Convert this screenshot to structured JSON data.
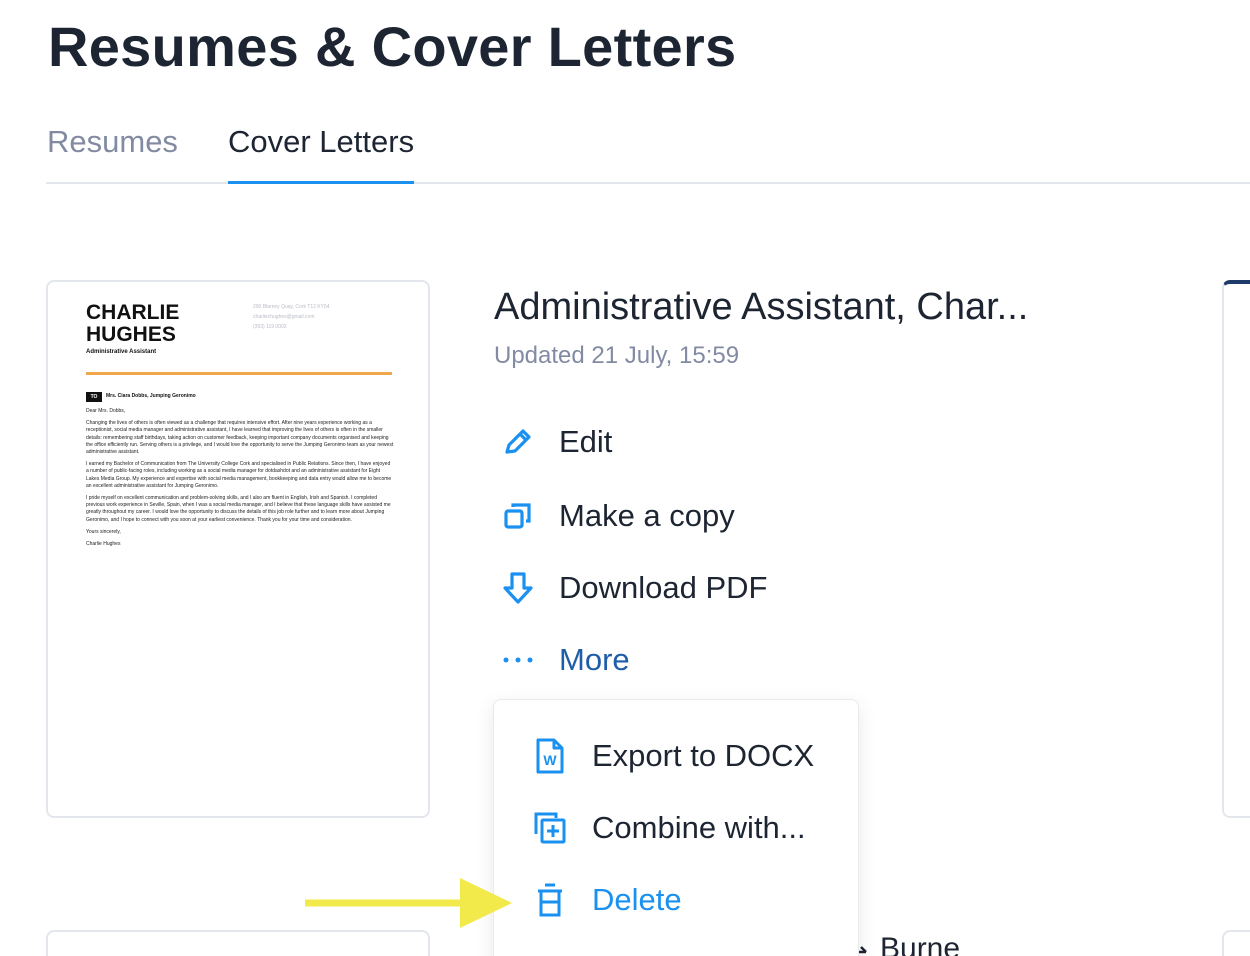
{
  "header": {
    "title": "Resumes & Cover Letters"
  },
  "tabs": [
    {
      "label": "Resumes",
      "active": false
    },
    {
      "label": "Cover Letters",
      "active": true
    }
  ],
  "document": {
    "title": "Administrative Assistant, Char...",
    "updated": "Updated 21 July, 15:59",
    "preview": {
      "name_line1": "CHARLIE",
      "name_line2": "HUGHES",
      "role": "Administrative Assistant",
      "contact_line1": "200 Blarney Quay, Cork T12 KY54",
      "contact_line2": "charliechughes@gmail.com",
      "contact_line3": "(353) 119 0002",
      "to_tag": "TO",
      "to_name": "Mrs. Ciara Dobbs, Jumping Geronimo",
      "greeting": "Dear Mrs. Dobbs,",
      "para1": "Changing the lives of others is often viewed as a challenge that requires intensive effort. After nine years experience working as a receptionist, social media manager and administrative assistant, I have learned that improving the lives of others is often in the smaller details: remembering staff birthdays, taking action on customer feedback, keeping important company documents organised and keeping the office efficiently run. Serving others is a privilege, and I would love the opportunity to serve the Jumping Geronimo team as your newest administrative assistant.",
      "para2": "I earned my Bachelor of Communication from The University College Cork and specialised in Public Relations. Since then, I have enjoyed a number of public-facing roles, including working as a social media manager for dotdashdot and an administrative assistant for Eight Lakes Media Group. My experience and expertise with social media management, bookkeeping and data entry would allow me to become an excellent administrative assistant for Jumping Geronimo.",
      "para3": "I pride myself on excellent communication and problem-solving skills, and I also am fluent in English, Irish and Spanish. I completed previous work experience in Seville, Spain, when I was a social media manager, and I believe that these language skills have assisted me greatly throughout my career. I would love the opportunity to discuss the details of this job role further and to learn more about Jumping Geronimo, and I hope to connect with you soon at your earliest convenience. Thank you for your time and consideration.",
      "closing": "Yours sincerely,",
      "signature": "Charlie Hughes"
    }
  },
  "actions": [
    {
      "label": "Edit",
      "icon": "pencil-icon"
    },
    {
      "label": "Make a copy",
      "icon": "copy-icon"
    },
    {
      "label": "Download PDF",
      "icon": "download-icon"
    },
    {
      "label": "More",
      "icon": "ellipsis-icon"
    }
  ],
  "more_menu": [
    {
      "label": "Export to DOCX",
      "icon": "word-doc-icon"
    },
    {
      "label": "Combine with...",
      "icon": "combine-icon"
    },
    {
      "label": "Delete",
      "icon": "trash-icon"
    }
  ],
  "peek": {
    "text": "Burne"
  },
  "colors": {
    "accent": "#1a91f0",
    "text": "#1e2532",
    "muted": "#828ba2",
    "more": "#1e5da8",
    "pointer": "#f2e94a",
    "preview_rule": "#f0a64a"
  }
}
